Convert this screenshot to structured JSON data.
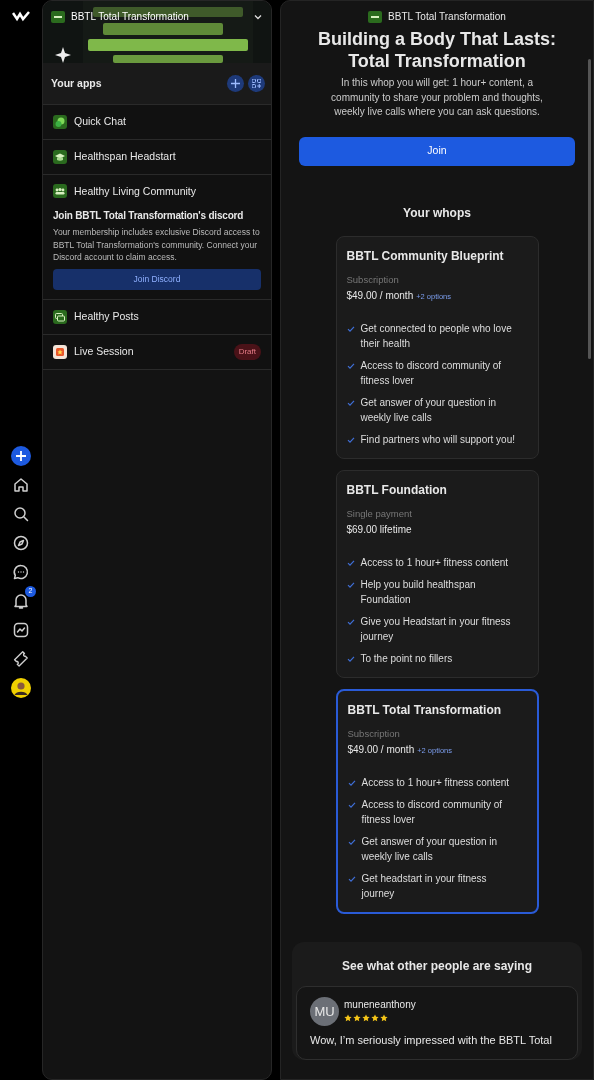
{
  "rail": {
    "notification_count": "2"
  },
  "sidebar": {
    "header": {
      "title": "BBTL Total Transformation"
    },
    "apps_title": "Your apps",
    "apps": [
      {
        "kind": "app",
        "name": "Quick Chat"
      },
      {
        "kind": "app",
        "name": "Healthspan Headstart"
      },
      {
        "kind": "discord",
        "name": "Healthy Living Community",
        "discord_title": "Join BBTL Total Transformation's discord",
        "discord_text": "Your membership includes exclusive Discord access to BBTL Total Transformation's community. Connect your Discord account to claim access.",
        "discord_button": "Join Discord"
      },
      {
        "kind": "app",
        "name": "Healthy Posts"
      },
      {
        "kind": "app",
        "name": "Live Session",
        "badge": "Draft"
      }
    ]
  },
  "main": {
    "brand": "BBTL Total Transformation",
    "title": "Building a Body That Lasts: Total Transformation",
    "description": "In this whop you will get: 1 hour+ content, a community to share your problem and thoughts, weekly live calls where you can ask questions.",
    "join_button": "Join",
    "section_title": "Your whops",
    "plans": [
      {
        "name": "BBTL Community Blueprint",
        "billing": "Subscription",
        "price": "$49.00 / month",
        "options": "+2 options",
        "selected": false,
        "features": [
          "Get connected to people who love their health",
          "Access to discord community of fitness lover",
          "Get answer of your question in weekly live calls",
          "Find partners who will support you!"
        ]
      },
      {
        "name": "BBTL Foundation",
        "billing": "Single payment",
        "price": "$69.00 lifetime",
        "selected": false,
        "features": [
          "Access to 1 hour+ fitness content",
          "Help you build healthspan Foundation",
          "Give you Headstart in your fitness journey",
          "To the point no fillers"
        ]
      },
      {
        "name": "BBTL Total Transformation",
        "billing": "Subscription",
        "price": "$49.00 / month",
        "options": "+2 options",
        "selected": true,
        "features": [
          "Access to 1 hour+ fitness content",
          "Access to discord community of fitness lover",
          "Get answer of your question in weekly live calls",
          "Get headstart in your fitness journey"
        ]
      }
    ],
    "reviews_title": "See what other people are saying",
    "reviews": [
      {
        "initials": "MU",
        "user": "muneneanthony",
        "stars": 5,
        "text": "Wow, I’m seriously impressed with the BBTL Total"
      }
    ]
  }
}
